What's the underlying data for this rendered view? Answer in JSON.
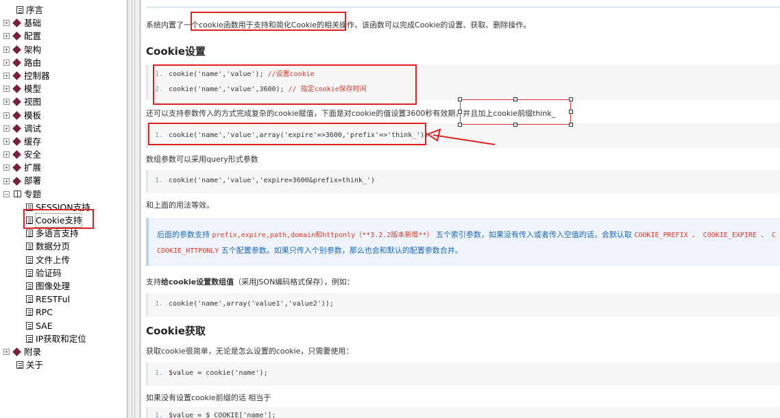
{
  "sidebar": {
    "items": [
      {
        "label": "序言",
        "kind": "doc",
        "level": "root"
      },
      {
        "label": "基础",
        "kind": "folder"
      },
      {
        "label": "配置",
        "kind": "folder"
      },
      {
        "label": "架构",
        "kind": "folder"
      },
      {
        "label": "路由",
        "kind": "folder"
      },
      {
        "label": "控制器",
        "kind": "folder"
      },
      {
        "label": "模型",
        "kind": "folder"
      },
      {
        "label": "视图",
        "kind": "folder"
      },
      {
        "label": "模板",
        "kind": "folder"
      },
      {
        "label": "调试",
        "kind": "folder"
      },
      {
        "label": "缓存",
        "kind": "folder"
      },
      {
        "label": "安全",
        "kind": "folder"
      },
      {
        "label": "扩展",
        "kind": "folder"
      },
      {
        "label": "部署",
        "kind": "folder"
      },
      {
        "label": "专题",
        "kind": "book"
      },
      {
        "label": "SESSION支持",
        "kind": "doc",
        "level": "child"
      },
      {
        "label": "Cookie支持",
        "kind": "doc",
        "level": "child",
        "selected": true
      },
      {
        "label": "多语言支持",
        "kind": "doc",
        "level": "child"
      },
      {
        "label": "数据分页",
        "kind": "doc",
        "level": "child"
      },
      {
        "label": "文件上传",
        "kind": "doc",
        "level": "child"
      },
      {
        "label": "验证码",
        "kind": "doc",
        "level": "child"
      },
      {
        "label": "图像处理",
        "kind": "doc",
        "level": "child"
      },
      {
        "label": "RESTFul",
        "kind": "doc",
        "level": "child"
      },
      {
        "label": "RPC",
        "kind": "doc",
        "level": "child"
      },
      {
        "label": "SAE",
        "kind": "doc",
        "level": "child"
      },
      {
        "label": "IP获取和定位",
        "kind": "doc",
        "level": "child"
      },
      {
        "label": "附录",
        "kind": "folder"
      },
      {
        "label": "关于",
        "kind": "doc",
        "level": "root"
      }
    ],
    "expand_plus": "+",
    "expand_minus": "−"
  },
  "content": {
    "intro": "系统内置了一个cookie函数用于支持和简化Cookie的相关操作，该函数可以完成Cookie的设置、获取、删除操作。",
    "h_set": "Cookie设置",
    "code1": [
      {
        "n": "1.",
        "code": "cookie('name','value');",
        "comment": "  //设置cookie"
      },
      {
        "n": "2.",
        "code": "cookie('name','value',3600);",
        "comment": " // 指定cookie保存时间"
      }
    ],
    "p_params": "还可以支持参数传入的方式完成复杂的cookie赋值，下面是对cookie的值设置3600秒有效期，并且加上cookie前缀think_",
    "code2": [
      {
        "n": "1.",
        "code": "cookie('name','value',array('expire'=>3600,'prefix'=>'think_'))"
      }
    ],
    "p_query": "数组参数可以采用query形式参数",
    "code3": [
      {
        "n": "1.",
        "code": "cookie('name','value','expire=3600&prefix=think_')"
      }
    ],
    "p_same": "和上面的用法等效。",
    "note_line1_a": "后面的参数支持 ",
    "note_line1_mono": "prefix,expire,path,domain和httponly（**3.2.2版本新增**）",
    "note_line1_b": " 五个索引参数，如果没有传入或者传入空值的话，会默认取 ",
    "note_line1_mono2": "COOKIE_PREFIX 、 COOKIE_EXPIRE 、 C",
    "note_line2_mono": "COOKIE_HTTPONLY",
    "note_line2_b": " 五个配置参数。如果只传入个别参数，那么也会和默认的配置参数合并。",
    "p_array_a": "支持",
    "p_array_bold": "给cookie设置数组值",
    "p_array_b": "（采用JSON编码格式保存），例如：",
    "code4": [
      {
        "n": "1.",
        "code": "cookie('name',array('value1','value2'));"
      }
    ],
    "h_get": "Cookie获取",
    "p_get": "获取cookie很简单，无论是怎么设置的cookie，只需要使用：",
    "code5": [
      {
        "n": "1.",
        "code": "$value = cookie('name');"
      }
    ],
    "p_prefix": "如果没有设置cookie前缀的话 相当于",
    "code6": [
      {
        "n": "1.",
        "code": "$value = $_COOKIE['name'];"
      }
    ]
  },
  "colors": {
    "annotation_red": "#e02020",
    "note_blue": "#1e68b8",
    "code_red": "#d43a2c",
    "line_num_blue": "#6aa1d6"
  }
}
